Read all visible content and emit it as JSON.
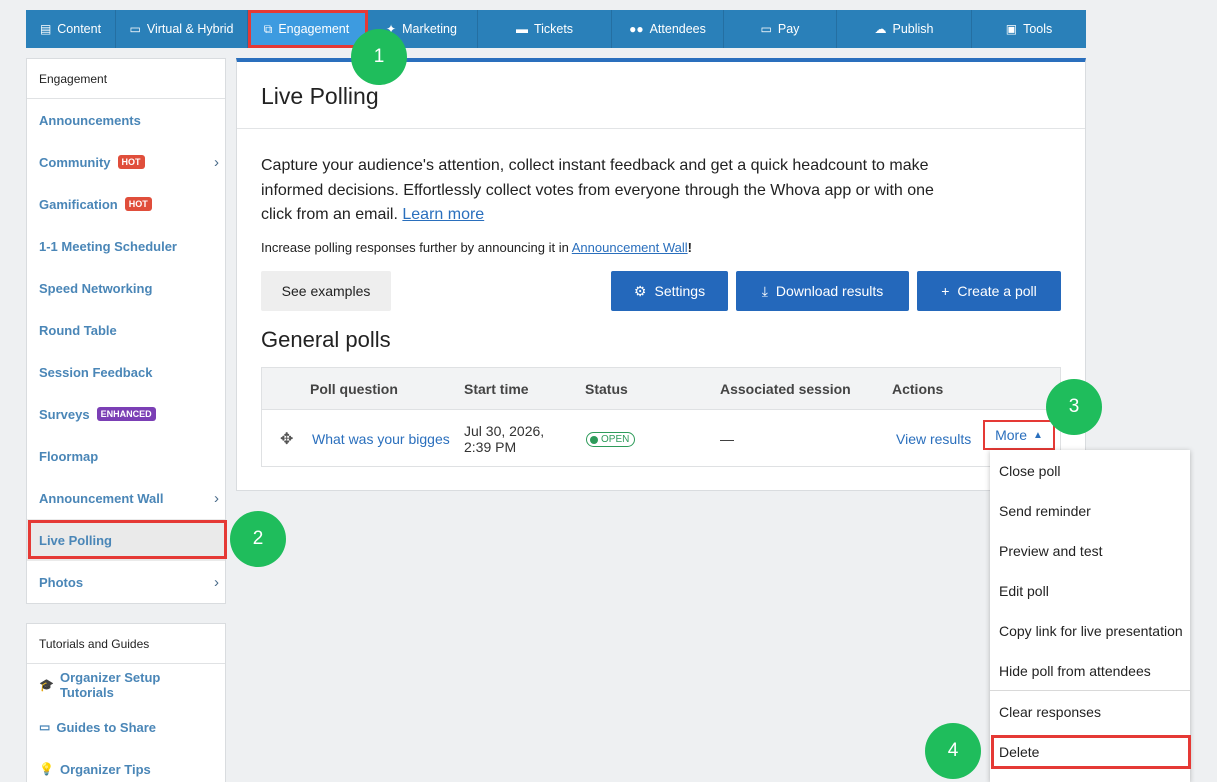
{
  "nav": {
    "items": [
      {
        "label": "Content",
        "icon": "list-icon"
      },
      {
        "label": "Virtual & Hybrid",
        "icon": "laptop-icon"
      },
      {
        "label": "Engagement",
        "icon": "network-icon"
      },
      {
        "label": "Marketing",
        "icon": "megaphone-icon"
      },
      {
        "label": "Tickets",
        "icon": "ticket-icon"
      },
      {
        "label": "Attendees",
        "icon": "users-icon"
      },
      {
        "label": "Pay",
        "icon": "card-icon"
      },
      {
        "label": "Publish",
        "icon": "cloud-upload-icon"
      },
      {
        "label": "Tools",
        "icon": "toolbox-icon"
      }
    ],
    "active_color": "#3d9be0",
    "bar_color": "#2a80b9"
  },
  "sidebar": {
    "header": "Engagement",
    "items": [
      {
        "label": "Announcements"
      },
      {
        "label": "Community",
        "badge": "HOT"
      },
      {
        "label": "Gamification",
        "badge": "HOT"
      },
      {
        "label": "1-1 Meeting Scheduler"
      },
      {
        "label": "Speed Networking"
      },
      {
        "label": "Round Table"
      },
      {
        "label": "Session Feedback"
      },
      {
        "label": "Surveys",
        "badge": "ENHANCED"
      },
      {
        "label": "Floormap"
      },
      {
        "label": "Announcement Wall"
      },
      {
        "label": "Live Polling"
      },
      {
        "label": "Photos"
      }
    ]
  },
  "tutorials": {
    "header": "Tutorials and Guides",
    "items": [
      {
        "label": "Organizer Setup Tutorials"
      },
      {
        "label": "Guides to Share"
      },
      {
        "label": "Organizer Tips"
      }
    ]
  },
  "main": {
    "title": "Live Polling",
    "description": "Capture your audience's attention, collect instant feedback and get a quick headcount to make informed decisions. Effortlessly collect votes from everyone through the Whova app or with one click from an email.",
    "learn_more": "Learn more",
    "note_prefix": "Increase polling responses further by announcing it in",
    "note_link": "Announcement Wall",
    "note_suffix": "!",
    "buttons": {
      "examples": "See examples",
      "settings": "Settings",
      "download": "Download results",
      "create": "Create a poll"
    },
    "section_title": "General polls",
    "table": {
      "headers": [
        "Poll question",
        "Start time",
        "Status",
        "Associated session",
        "Actions"
      ],
      "row": {
        "question": "What was your biggest",
        "start_date": "Jul 30, 2026,",
        "start_time": "2:39 PM",
        "status": "OPEN",
        "session": "—",
        "view": "View results",
        "more": "More"
      }
    }
  },
  "dropdown": {
    "items": [
      "Close poll",
      "Send reminder",
      "Preview and test",
      "Edit poll",
      "Copy link for live presentation",
      "Hide poll from attendees",
      "Clear responses",
      "Delete"
    ]
  },
  "steps": [
    "1",
    "2",
    "3",
    "4"
  ],
  "colors": {
    "highlight": "#e53935",
    "step": "#1fbd5c",
    "link": "#2a6fbd",
    "button": "#2468bb"
  }
}
